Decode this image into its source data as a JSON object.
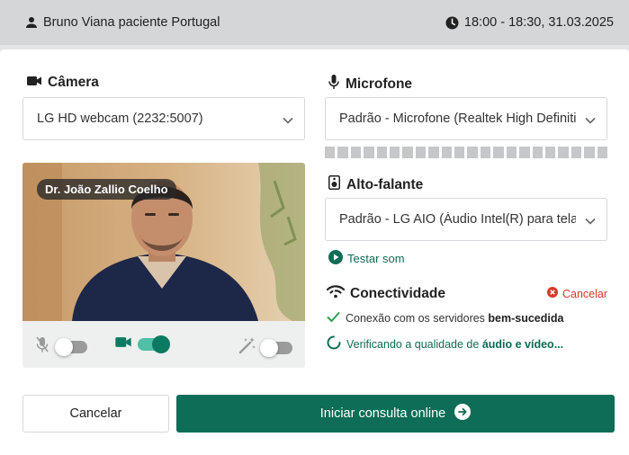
{
  "header": {
    "patient": "Bruno Viana paciente Portugal",
    "schedule": "18:00 - 18:30, 31.03.2025"
  },
  "camera": {
    "label": "Câmera",
    "selected": "LG HD webcam (2232:5007)"
  },
  "microphone": {
    "label": "Microfone",
    "selected": "Padrão - Microfone (Realtek High Definition Audio)",
    "level": 0
  },
  "speaker": {
    "label": "Alto-falante",
    "selected": "Padrão - LG AIO (Áudio Intel(R) para telas)",
    "test_label": "Testar som"
  },
  "preview": {
    "name_tag": "Dr. João Zallio Coelho",
    "controls": {
      "microphone_on": false,
      "camera_on": true,
      "background_effect_on": false
    }
  },
  "connectivity": {
    "label": "Conectividade",
    "cancel_label": "Cancelar",
    "server_prefix": "Conexão com os servidores ",
    "server_status": "bem-sucedida",
    "quality_prefix": "Verificando a qualidade de ",
    "quality_subject": "áudio e vídeo...",
    "colors": {
      "success": "#2e9e4f",
      "error": "#d33a2c",
      "accent": "#0d6d56"
    }
  },
  "actions": {
    "cancel_label": "Cancelar",
    "start_label": "Iniciar consulta online"
  }
}
